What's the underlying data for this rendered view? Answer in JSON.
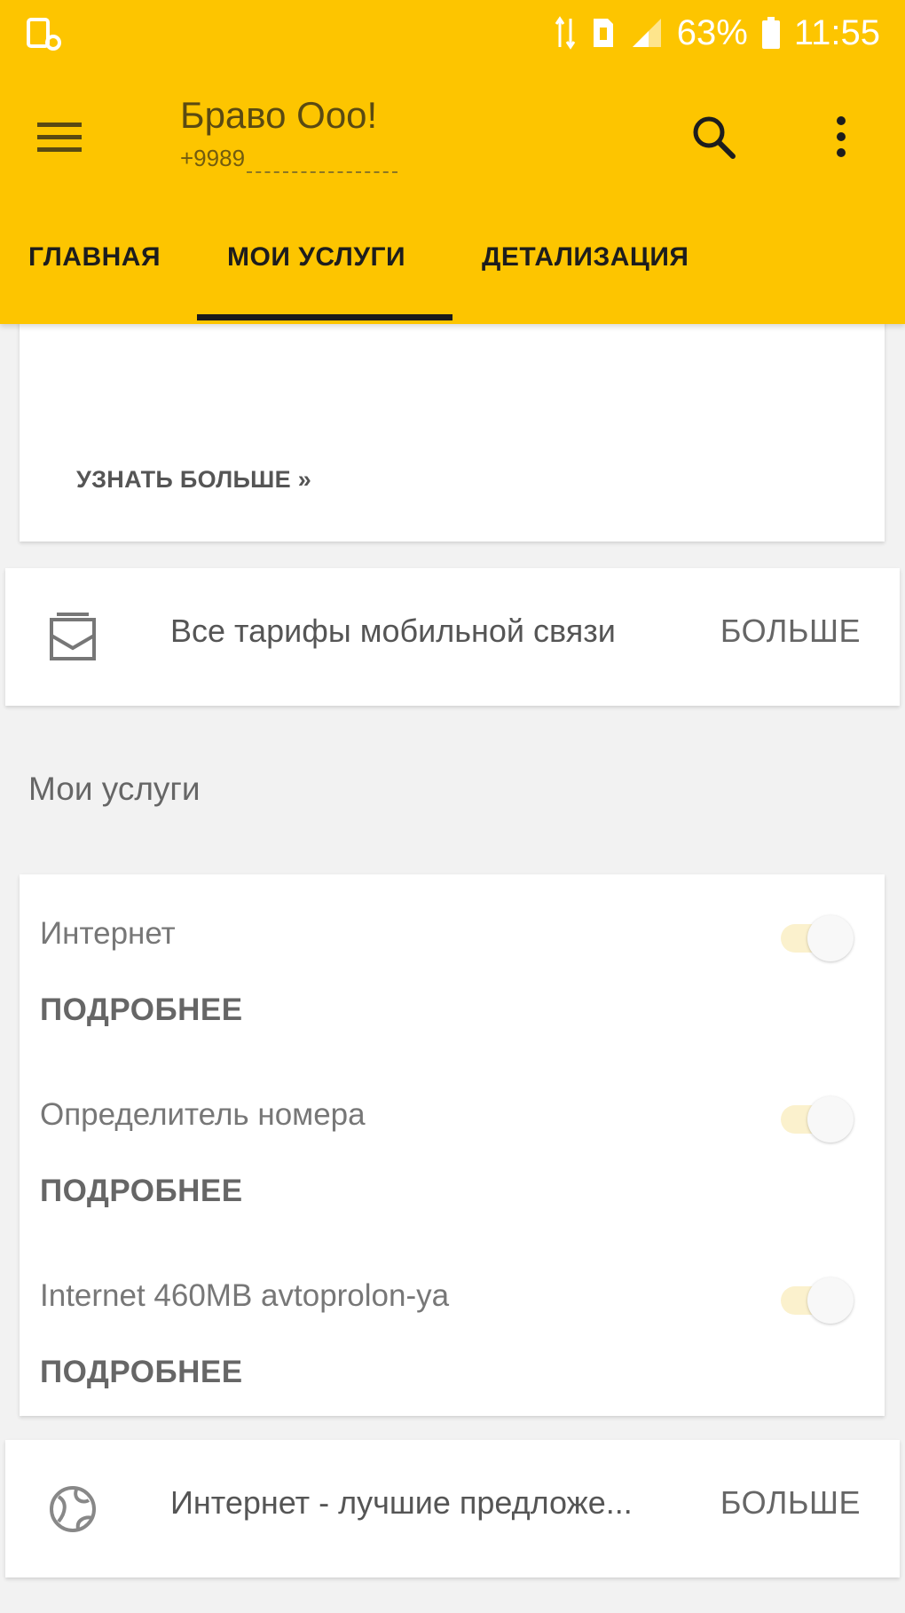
{
  "status_bar": {
    "battery": "63%",
    "time": "11:55"
  },
  "toolbar": {
    "title": "Браво Ooo!",
    "subtitle": "+9989"
  },
  "tabs": [
    {
      "label": "ГЛАВНАЯ",
      "active": false
    },
    {
      "label": "МОИ УСЛУГИ",
      "active": true
    },
    {
      "label": "ДЕТАЛИЗАЦИЯ",
      "active": false
    }
  ],
  "promo": {
    "learn_more": "УЗНАТЬ БОЛЬШЕ »"
  },
  "tariffs_row": {
    "icon": "sim-card-icon",
    "text": "Все тарифы мобильной связи",
    "more": "БОЛЬШЕ"
  },
  "services_section": {
    "title": "Мои услуги",
    "items": [
      {
        "name": "Интернет",
        "more": "ПОДРОБНЕЕ",
        "enabled": true
      },
      {
        "name": "Определитель номера",
        "more": "ПОДРОБНЕЕ",
        "enabled": true
      },
      {
        "name": "Internet 460MB avtoprolon-ya",
        "more": "ПОДРОБНЕЕ",
        "enabled": true
      }
    ]
  },
  "internet_row": {
    "icon": "globe-icon",
    "text": "Интернет - лучшие предложе...",
    "more": "БОЛЬШЕ"
  },
  "colors": {
    "accent": "#fdc500",
    "background": "#f2f2f2",
    "indicator": "#1a1a1a"
  }
}
